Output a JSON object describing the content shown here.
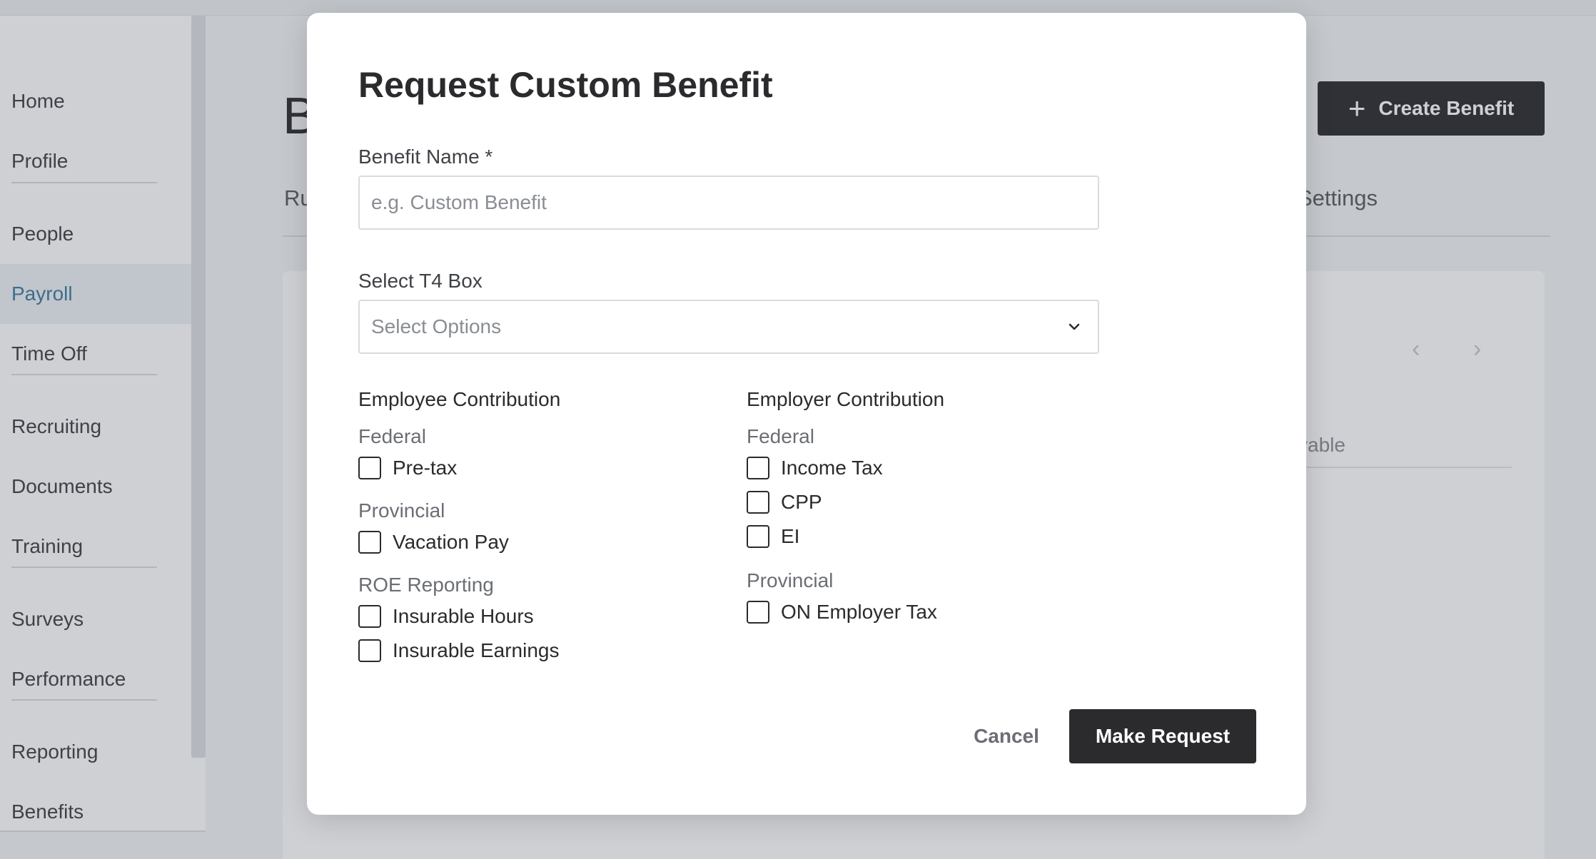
{
  "sidebar": {
    "items": [
      {
        "label": "Home"
      },
      {
        "label": "Profile"
      },
      {
        "label": "People"
      },
      {
        "label": "Payroll",
        "active": true
      },
      {
        "label": "Time Off"
      },
      {
        "label": "Recruiting"
      },
      {
        "label": "Documents"
      },
      {
        "label": "Training"
      },
      {
        "label": "Surveys"
      },
      {
        "label": "Performance"
      },
      {
        "label": "Reporting"
      },
      {
        "label": "Benefits"
      }
    ]
  },
  "page": {
    "title_partial": "B",
    "tab_left_partial": "Ru",
    "tab_settings_partial": "Settings",
    "create_button_label": "Create Benefit",
    "plus_icon": "+",
    "pager_prev": "‹",
    "pager_next": "›",
    "column_partial": "yable"
  },
  "modal": {
    "title": "Request Custom Benefit",
    "benefit_name": {
      "label": "Benefit Name *",
      "value": "",
      "placeholder": "e.g. Custom Benefit"
    },
    "t4_box": {
      "label": "Select T4 Box",
      "selected": "Select Options"
    },
    "employee_contribution": {
      "title": "Employee Contribution",
      "federal_label": "Federal",
      "federal": [
        {
          "label": "Pre-tax",
          "checked": false
        }
      ],
      "provincial_label": "Provincial",
      "provincial": [
        {
          "label": "Vacation Pay",
          "checked": false
        }
      ],
      "roe_label": "ROE Reporting",
      "roe": [
        {
          "label": "Insurable Hours",
          "checked": false
        },
        {
          "label": "Insurable Earnings",
          "checked": false
        }
      ]
    },
    "employer_contribution": {
      "title": "Employer Contribution",
      "federal_label": "Federal",
      "federal": [
        {
          "label": "Income Tax",
          "checked": false
        },
        {
          "label": "CPP",
          "checked": false
        },
        {
          "label": "EI",
          "checked": false
        }
      ],
      "provincial_label": "Provincial",
      "provincial": [
        {
          "label": "ON Employer Tax",
          "checked": false
        }
      ]
    },
    "cancel_label": "Cancel",
    "submit_label": "Make Request"
  },
  "colors": {
    "primary_dark": "#2b2b2e",
    "active_nav_text": "#3f7aa0",
    "active_nav_bg": "#eef2f6",
    "overlay": "rgba(60,66,80,0.25)"
  }
}
